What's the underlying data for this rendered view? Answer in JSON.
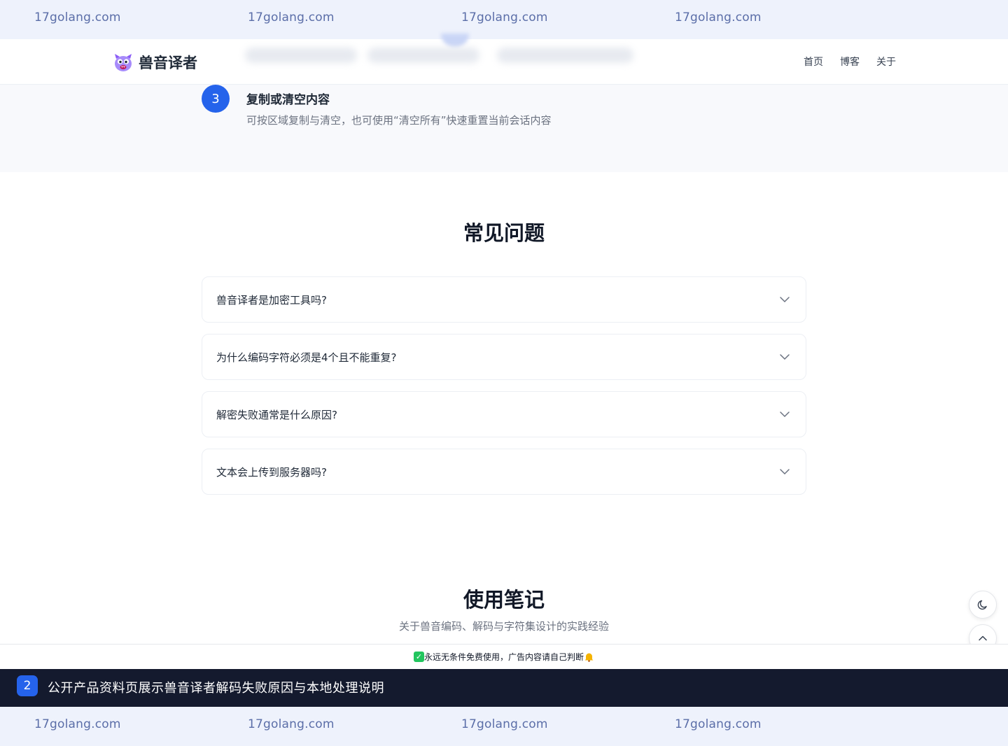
{
  "watermark": {
    "top": [
      "17golang.com",
      "17golang.com",
      "17golang.com",
      "17golang.com"
    ],
    "bottom": [
      "17golang.com",
      "17golang.com",
      "17golang.com",
      "17golang.com"
    ]
  },
  "header": {
    "logo_text": "兽音译者",
    "nav": [
      "首页",
      "博客",
      "关于"
    ]
  },
  "step": {
    "number": "3",
    "title": "复制或清空内容",
    "desc": "可按区域复制与清空，也可使用“清空所有”快速重置当前会话内容"
  },
  "faq": {
    "title": "常见问题",
    "items": [
      "兽音译者是加密工具吗?",
      "为什么编码字符必须是4个且不能重复?",
      "解密失败通常是什么原因?",
      "文本会上传到服务器吗?"
    ]
  },
  "notes": {
    "title": "使用笔记",
    "subtitle": "关于兽音编码、解码与字符集设计的实践经验"
  },
  "notice": {
    "text": "永远无条件免费使用，广告内容请自己判断"
  },
  "caption": {
    "number": "2",
    "text": "公开产品资料页展示兽音译者解码失败原因与本地处理说明"
  },
  "colors": {
    "accent": "#2563eb",
    "caption_bg": "#141a2e",
    "watermark_bg": "#eef2fc"
  }
}
